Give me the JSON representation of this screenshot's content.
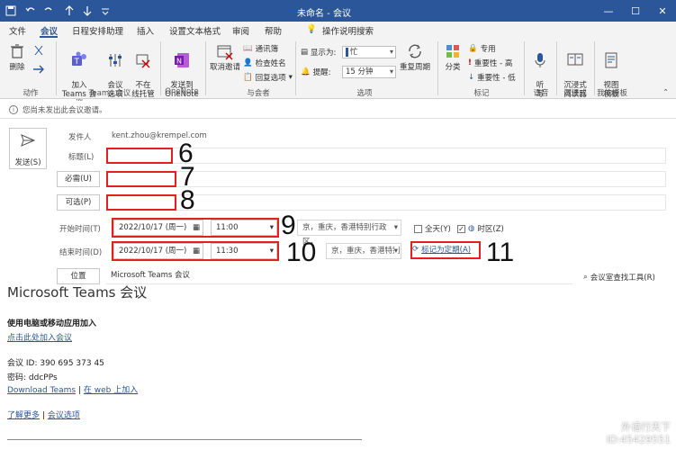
{
  "title_bar": {
    "title": "未命名 - 会议"
  },
  "menu": {
    "items": [
      "文件",
      "会议",
      "日程安排助理",
      "插入",
      "设置文本格式",
      "审阅",
      "帮助"
    ],
    "search": "操作说明搜索"
  },
  "ribbon": {
    "delete": "删除",
    "actions_group": "动作",
    "teams_join": "加入\nTeams 会议",
    "meeting_options": "会议\n选项",
    "not_in_whiteboard": "不在\n线托管",
    "teams_group": "Teams 会议",
    "send_to_onenote": "发送到\nOneNote",
    "onenote_group": "OneNote",
    "cancel_invite": "取消邀请",
    "address_book": "通讯簿",
    "check_names": "检查姓名",
    "response_options": "回复选项",
    "attendees_group": "与会者",
    "show_as_label": "显示为:",
    "show_as_value": "忙",
    "reminder_label": "提醒:",
    "reminder_value": "15 分钟",
    "recurrence": "重复周期",
    "options_group": "选项",
    "categorize": "分类",
    "private": "专用",
    "high_importance": "重要性 - 高",
    "low_importance": "重要性 - 低",
    "tags_group": "标记",
    "dictate": "听\n写",
    "voice_group": "语音",
    "immersive_reader": "沉浸式\n阅读器",
    "immersive_group": "沉浸式",
    "view_templates": "视图\n模板",
    "templates_group": "我的模板"
  },
  "info_bar": {
    "text": "您尚未发出此会议邀请。"
  },
  "form": {
    "send": "发送(S)",
    "from_label": "发件人",
    "from_value": "kent.zhou@krempel.com",
    "title_label": "标题(L)",
    "required_label": "必需(U)",
    "optional_label": "可选(P)",
    "start_label": "开始时间(T)",
    "start_date": "2022/10/17 (周一)",
    "start_time": "11:00",
    "end_label": "结束时间(D)",
    "end_date": "2022/10/17 (周一)",
    "end_time": "11:30",
    "timezone": "京，重庆，香港特别行政区，",
    "all_day": "全天(Y)",
    "time_zones": "时区(Z)",
    "make_recurring": "标记为定期(A)",
    "location_label": "位置",
    "location_value": "Microsoft Teams 会议",
    "room_finder": "会议室查找工具(R)",
    "annotations": [
      "6",
      "7",
      "8",
      "9",
      "10",
      "11"
    ]
  },
  "body": {
    "heading": "Microsoft Teams 会议",
    "join_line": "使用电脑或移动应用加入",
    "click_join": "点击此处加入会议",
    "meeting_id": "会议 ID: 390 695 373 45",
    "passcode": "密码: ddcPPs",
    "download": "Download Teams",
    "sep": "|",
    "web_join": "在 web 上加入",
    "learn_more": "了解更多",
    "meeting_options": "会议选项",
    "watermark_line1": "外语行天下",
    "watermark_line2": "ID:45429551"
  }
}
